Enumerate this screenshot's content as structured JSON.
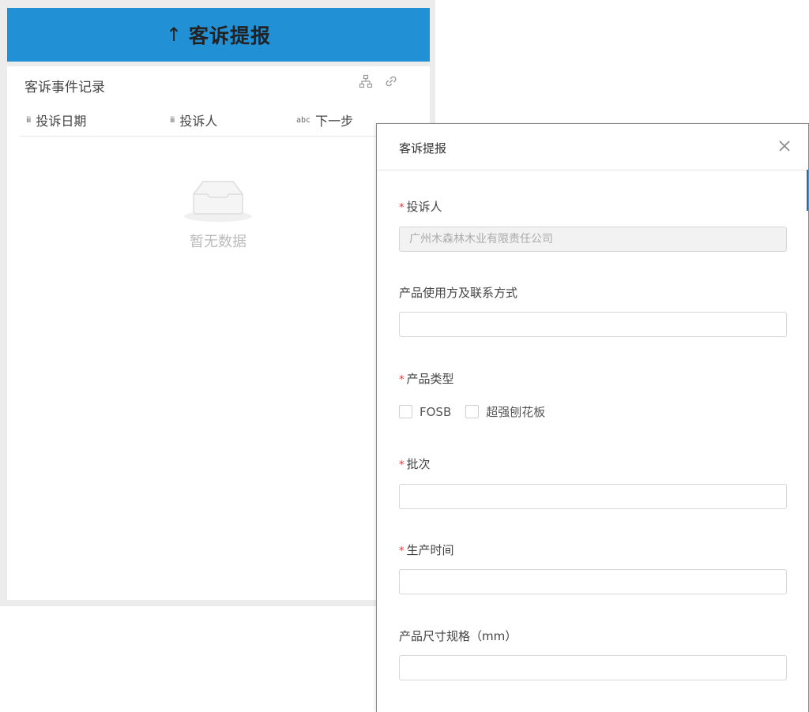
{
  "header": {
    "arrow": "↑",
    "title": "客诉提报"
  },
  "card": {
    "title": "客诉事件记录",
    "columns": [
      {
        "tag": "ⅲ",
        "label": "投诉日期"
      },
      {
        "tag": "ⅲ",
        "label": "投诉人"
      },
      {
        "tag": "abc",
        "label": "下一步"
      }
    ],
    "empty_text": "暂无数据"
  },
  "dialog": {
    "title": "客诉提报",
    "fields": {
      "complainant": {
        "label": "投诉人",
        "value": "广州木森林木业有限责任公司"
      },
      "contact": {
        "label": "产品使用方及联系方式",
        "value": ""
      },
      "product_type": {
        "label": "产品类型",
        "options": [
          "FOSB",
          "超强刨花板"
        ]
      },
      "batch": {
        "label": "批次",
        "value": ""
      },
      "prod_time": {
        "label": "生产时间",
        "value": ""
      },
      "size": {
        "label": "产品尺寸规格（mm）",
        "value": ""
      }
    },
    "required_mark": "*"
  }
}
